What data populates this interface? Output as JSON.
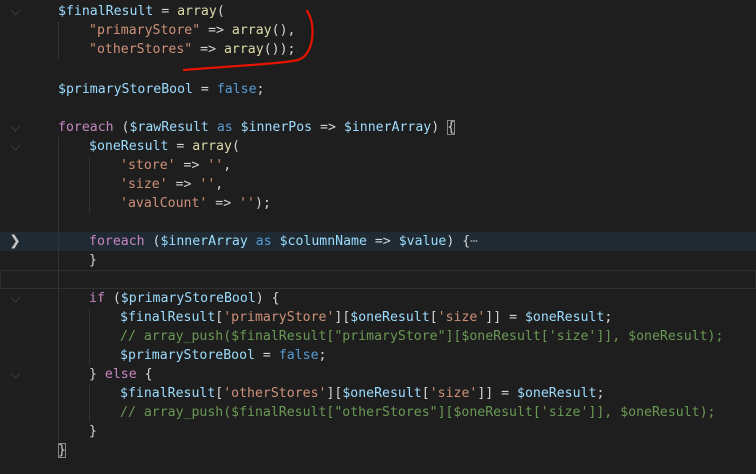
{
  "editor": {
    "lines": [
      {
        "id": 1,
        "fold": "down",
        "text": ""
      },
      {
        "id": 2,
        "fold": "none",
        "text": ""
      },
      {
        "id": 3,
        "fold": "none",
        "text": ""
      },
      {
        "id": 4,
        "fold": "none",
        "text": ""
      },
      {
        "id": 5,
        "fold": "none",
        "text": ""
      },
      {
        "id": 6,
        "fold": "down",
        "text": ""
      }
    ],
    "code": {
      "l1_var": "$finalResult",
      "l1_op": " = ",
      "l1_fn": "array",
      "l1_paren": "(",
      "l2_str": "\"primaryStore\"",
      "l2_arrow": " => ",
      "l2_fn": "array",
      "l2_tail": "(),",
      "l3_str": "\"otherStores\"",
      "l3_arrow": " => ",
      "l3_fn": "array",
      "l3_tail": "());",
      "l5_var": "$primaryStoreBool",
      "l5_op": " = ",
      "l5_kw": "false",
      "l5_semi": ";",
      "l7_kw": "foreach",
      "l7_open": " (",
      "l7_v1": "$rawResult",
      "l7_as": " as ",
      "l7_v2": "$innerPos",
      "l7_arrow": " => ",
      "l7_v3": "$innerArray",
      "l7_close": ") ",
      "l7_brace": "{",
      "l8_var": "$oneResult",
      "l8_op": " = ",
      "l8_fn": "array",
      "l8_paren": "(",
      "l9_str": "'store'",
      "l9_arrow": " => ",
      "l9_val": "''",
      "l9_comma": ",",
      "l10_str": "'size'",
      "l10_arrow": " => ",
      "l10_val": "''",
      "l10_comma": ",",
      "l11_str": "'avalCount'",
      "l11_arrow": " => ",
      "l11_val": "''",
      "l11_tail": ");",
      "l13_kw": "foreach",
      "l13_open": " (",
      "l13_v1": "$innerArray",
      "l13_as": " as ",
      "l13_v2": "$columnName",
      "l13_arrow": " => ",
      "l13_v3": "$value",
      "l13_close": ") {",
      "l13_ellipsis": "⋯",
      "l14_brace": "}",
      "l16_kw": "if",
      "l16_open": " (",
      "l16_var": "$primaryStoreBool",
      "l16_close": ") {",
      "l17_v1": "$finalResult",
      "l17_b1": "[",
      "l17_s1": "'primaryStore'",
      "l17_b2": "][",
      "l17_v2": "$oneResult",
      "l17_b3": "[",
      "l17_s2": "'size'",
      "l17_b4": "]] = ",
      "l17_v3": "$oneResult",
      "l17_semi": ";",
      "l18_comment": "// array_push($finalResult[\"primaryStore\"][$oneResult['size']], $oneResult);",
      "l19_var": "$primaryStoreBool",
      "l19_op": " = ",
      "l19_kw": "false",
      "l19_semi": ";",
      "l20_open": "} ",
      "l20_kw": "else",
      "l20_close": " {",
      "l21_v1": "$finalResult",
      "l21_b1": "[",
      "l21_s1": "'otherStores'",
      "l21_b2": "][",
      "l21_v2": "$oneResult",
      "l21_b3": "[",
      "l21_s2": "'size'",
      "l21_b4": "]] = ",
      "l21_v3": "$oneResult",
      "l21_semi": ";",
      "l22_comment": "// array_push($finalResult[\"otherStores\"][$oneResult['size']], $oneResult);",
      "l23_brace": "}",
      "l24_brace": "}"
    },
    "colors": {
      "background": "#1e1e1e",
      "variable": "#9cdcfe",
      "string": "#ce9178",
      "keyword": "#569cd6",
      "control": "#c586c0",
      "function": "#dcdcaa",
      "comment": "#6a9955",
      "annotation": "#e51400"
    },
    "icons": {
      "fold_collapsed": "chevron-right-icon",
      "fold_expanded": "chevron-down-icon"
    }
  }
}
